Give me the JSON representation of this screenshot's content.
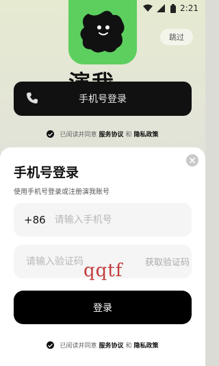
{
  "status_bar": {
    "time": "2:21"
  },
  "background": {
    "skip_label": "跳过",
    "brand_text": "演我",
    "phone_login_label": "手机号登录",
    "agree": {
      "prefix": "已阅读并同意",
      "service": "服务协议",
      "and": "和",
      "privacy": "隐私政策"
    }
  },
  "sheet": {
    "title": "手机号登录",
    "subtitle": "使用手机号登录或注册演我账号",
    "phone": {
      "country_code": "+86",
      "placeholder": "请输入手机号"
    },
    "code": {
      "placeholder": "请输入验证码",
      "get_code_label": "获取验证码"
    },
    "watermark": "qqtf",
    "login_label": "登录",
    "agree": {
      "prefix": "已阅读并同意",
      "service": "服务协议",
      "and": "和",
      "privacy": "隐私政策"
    }
  },
  "colors": {
    "logo_green": "#5dcf5f",
    "button_black": "#000000",
    "watermark_red": "#c23b3b"
  },
  "icons": [
    "wifi-icon",
    "signal-icon",
    "battery-icon",
    "phone-icon",
    "check-icon",
    "close-icon"
  ]
}
